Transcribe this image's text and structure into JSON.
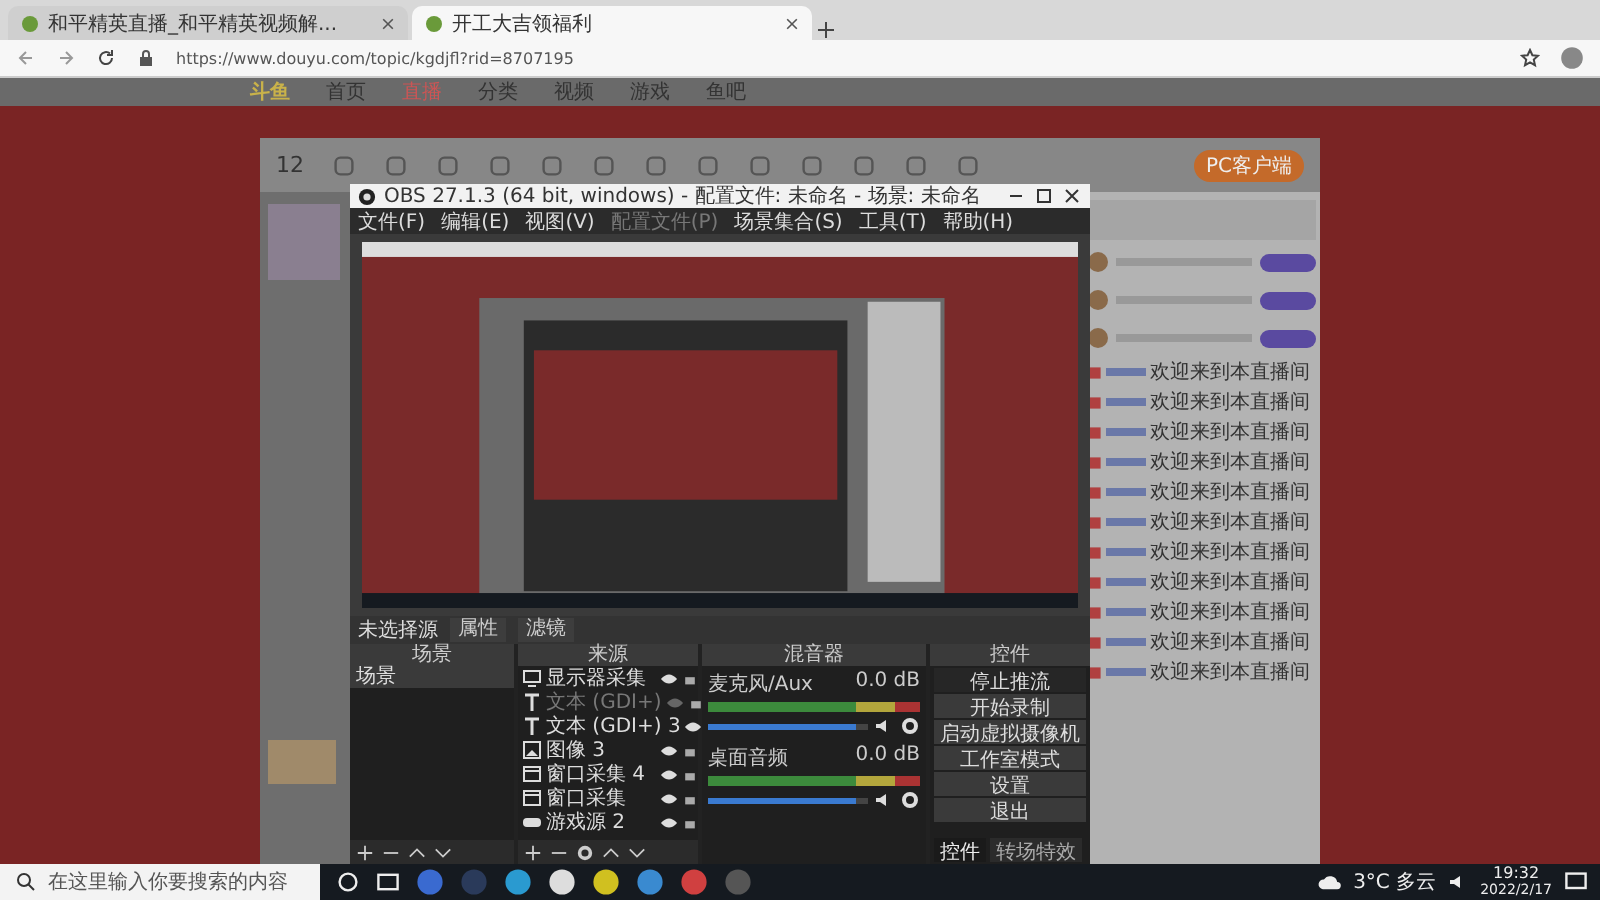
{
  "browser": {
    "tabs": [
      {
        "title": "和平精英直播_和平精英视频解...",
        "selected": false
      },
      {
        "title": "开工大吉领福利",
        "selected": true
      }
    ],
    "url": "https://www.douyu.com/topic/kgdjfl?rid=8707195"
  },
  "site_nav": {
    "logo": "斗鱼",
    "items": [
      {
        "label": "首页",
        "selected": false
      },
      {
        "label": "直播",
        "selected": true
      },
      {
        "label": "分类",
        "selected": false
      },
      {
        "label": "视频",
        "selected": false
      },
      {
        "label": "游戏",
        "selected": false
      },
      {
        "label": "鱼吧",
        "selected": false
      }
    ]
  },
  "room_toolbar": {
    "count": "12",
    "client_button": "PC客户端"
  },
  "obs": {
    "title": "OBS 27.1.3 (64 bit, windows) - 配置文件: 未命名 - 场景: 未命名",
    "menu": [
      {
        "label": "文件(F)",
        "disabled": false
      },
      {
        "label": "编辑(E)",
        "disabled": false
      },
      {
        "label": "视图(V)",
        "disabled": false
      },
      {
        "label": "配置文件(P)",
        "disabled": true
      },
      {
        "label": "场景集合(S)",
        "disabled": false
      },
      {
        "label": "工具(T)",
        "disabled": false
      },
      {
        "label": "帮助(H)",
        "disabled": false
      }
    ],
    "source_bar": {
      "label": "未选择源",
      "buttons": [
        "属性",
        "滤镜"
      ]
    },
    "scenes": {
      "title": "场景",
      "items": [
        {
          "label": "场景",
          "selected": true
        }
      ]
    },
    "sources": {
      "title": "来源",
      "items": [
        {
          "kind": "monitor",
          "label": "显示器采集",
          "visible": true
        },
        {
          "kind": "text",
          "label": "文本 (GDI+)",
          "visible": false
        },
        {
          "kind": "text",
          "label": "文本 (GDI+) 3",
          "visible": true
        },
        {
          "kind": "image",
          "label": "图像 3",
          "visible": true
        },
        {
          "kind": "window",
          "label": "窗口采集 4",
          "visible": true
        },
        {
          "kind": "window",
          "label": "窗口采集",
          "visible": true
        },
        {
          "kind": "game",
          "label": "游戏源 2",
          "visible": true
        }
      ]
    },
    "mixer": {
      "title": "混音器",
      "channels": [
        {
          "name": "麦克风/Aux",
          "reading": "0.0 dB",
          "level": 0.92
        },
        {
          "name": "桌面音频",
          "reading": "0.0 dB",
          "level": 0.92
        }
      ]
    },
    "controls": {
      "title": "控件",
      "buttons": [
        {
          "label": "停止推流",
          "active": true
        },
        {
          "label": "开始录制",
          "active": false
        },
        {
          "label": "启动虚拟摄像机",
          "active": false
        },
        {
          "label": "工作室模式",
          "active": false
        },
        {
          "label": "设置",
          "active": false
        },
        {
          "label": "退出",
          "active": false
        }
      ],
      "tabs": [
        {
          "label": "控件",
          "selected": true
        },
        {
          "label": "转场特效",
          "selected": false
        }
      ]
    }
  },
  "chat": {
    "messages": [
      {
        "text": "欢迎来到本直播间"
      },
      {
        "text": "欢迎来到本直播间"
      },
      {
        "text": "欢迎来到本直播间"
      },
      {
        "text": "欢迎来到本直播间"
      },
      {
        "text": "欢迎来到本直播间"
      },
      {
        "text": "欢迎来到本直播间"
      },
      {
        "text": "欢迎来到本直播间"
      },
      {
        "text": "欢迎来到本直播间"
      },
      {
        "text": "欢迎来到本直播间"
      },
      {
        "text": "欢迎来到本直播间"
      },
      {
        "text": "欢迎来到本直播间"
      }
    ]
  },
  "taskbar": {
    "search_placeholder": "在这里输入你要搜索的内容",
    "weather": "3°C 多云",
    "time": "19:32",
    "date": "2022/2/17"
  }
}
